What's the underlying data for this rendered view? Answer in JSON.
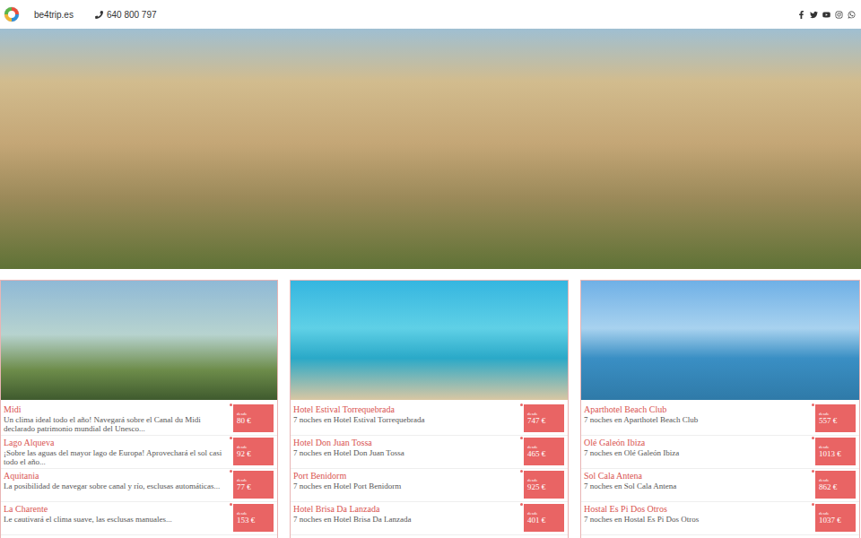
{
  "site": {
    "name": "be4trip.es",
    "phone": "640 800 797"
  },
  "sections": [
    {
      "items": [
        {
          "title": "Midi",
          "description": "Un clima ideal todo el año! Navegará sobre el Canal du Midi declarado patrimonio mundial del Unesco...",
          "price_label": "desde",
          "price": "80 €"
        },
        {
          "title": "Lago Alqueva",
          "description": "¡Sobre las aguas del mayor lago de Europa! Aprovechará el sol casi todo el año...",
          "price_label": "desde",
          "price": "92 €"
        },
        {
          "title": "Aquitania",
          "description": "La posibilidad de navegar sobre canal y río, esclusas automáticas...",
          "price_label": "desde",
          "price": "77 €"
        },
        {
          "title": "La Charente",
          "description": "Le cautivará el clima suave, las esclusas manuales...",
          "price_label": "desde",
          "price": "153 €"
        }
      ]
    },
    {
      "items": [
        {
          "title": "Hotel Estival Torrequebrada",
          "description": "7 noches en Hotel Estival Torrequebrada",
          "price_label": "desde",
          "price": "747 €"
        },
        {
          "title": "Hotel Don Juan Tossa",
          "description": "7 noches en Hotel Don Juan Tossa",
          "price_label": "desde",
          "price": "465 €"
        },
        {
          "title": "Port Benidorm",
          "description": "7 noches en Hotel Port Benidorm",
          "price_label": "desde",
          "price": "925 €"
        },
        {
          "title": "Hotel Brisa Da Lanzada",
          "description": "7 noches en Hotel Brisa Da Lanzada",
          "price_label": "desde",
          "price": "401 €"
        }
      ]
    },
    {
      "items": [
        {
          "title": "Aparthotel Beach Club",
          "description": "7 noches en Aparthotel Beach Club",
          "price_label": "desde",
          "price": "557 €"
        },
        {
          "title": "Olé Galeón Ibiza",
          "description": "7 noches en Olé Galeón Ibiza",
          "price_label": "desde",
          "price": "1013 €"
        },
        {
          "title": "Sol Cala Antena",
          "description": "7 noches en Sol Cala Antena",
          "price_label": "desde",
          "price": "862 €"
        },
        {
          "title": "Hostal Es Pi Dos Otros",
          "description": "7 noches en Hostal Es Pi Dos Otros",
          "price_label": "desde",
          "price": "1037 €"
        }
      ]
    }
  ]
}
